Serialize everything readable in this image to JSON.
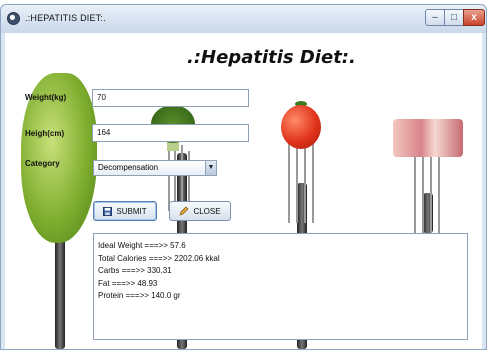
{
  "window": {
    "title": ".:HEPATITIS DIET:.",
    "min_glyph": "–",
    "max_glyph": "□",
    "close_glyph": "x"
  },
  "heading": ".:Hepatitis Diet:.",
  "form": {
    "weight_label": "Weight(kg)",
    "weight_value": "70",
    "height_label": "Heigh(cm)",
    "height_value": "164",
    "category_label": "Category",
    "category_value": "Decompensation",
    "category_arrow": "▼"
  },
  "buttons": {
    "submit_label": "SUBMIT",
    "close_label": "CLOSE",
    "submit_icon": "floppy-disk-icon",
    "close_icon": "pencil-icon"
  },
  "results": [
    "Ideal Weight ===>> 57.6",
    "Total Calories ===>> 2202.06 kkal",
    "Carbs ===>> 330.31",
    "Fat ===>> 48.93",
    "Protein ===>> 140.0 gr"
  ]
}
